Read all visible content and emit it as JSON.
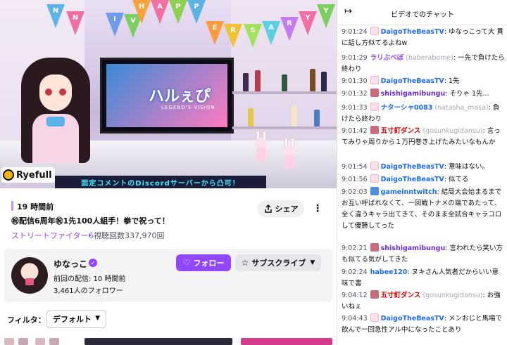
{
  "video": {
    "banner_letters": [
      "N",
      "N",
      "I",
      "V",
      "E",
      "R",
      "S",
      "A",
      "R",
      "Y",
      "H",
      "A",
      "P",
      "P",
      "Y"
    ],
    "tv_logo": "ハルぇぴ",
    "tv_sub": "LEGEND'S VISION",
    "marquee": "固定コメントのDiscordサーバーから凸可！",
    "sponsor": "Ryefull"
  },
  "info": {
    "time_ago": "19 時間前",
    "title": "㊗配信6周年㊗1先100人組手！拳で祝って！",
    "game": "ストリートファイター6",
    "views": "・視聴回数337,970回",
    "share_label": "シェア",
    "more_label": "⋮"
  },
  "channel": {
    "name": "ゆなっこ",
    "last_stream": "前回の配信: 10 時間前",
    "followers": "3,461人のフォロワー",
    "follow_label": "フォロー",
    "subscribe_label": "サブスクライブ"
  },
  "filter": {
    "label": "フィルタ：",
    "value": "デフォルト"
  },
  "chat": {
    "title": "ビデオでのチャット",
    "messages": [
      {
        "ts": "9:01:24",
        "badge": "bunny",
        "user": "DaigoTheBeasTV",
        "color": "#1e69ff",
        "alias": "",
        "text": "ゆなっこって大 貫に話し方似てるよねw"
      },
      {
        "ts": "9:01:29",
        "badge": "",
        "user": "ラリぶべぼ",
        "color": "#9147ff",
        "alias": "(baberabome)",
        "text": "一先で負けたら終わり"
      },
      {
        "ts": "9:01:30",
        "badge": "bunny",
        "user": "DaigoTheBeasTV",
        "color": "#1e69ff",
        "alias": "",
        "text": "1先"
      },
      {
        "ts": "9:01:32",
        "badge": "sub",
        "user": "shishigamibungu",
        "color": "#6a2cd6",
        "alias": "",
        "text": "そりゃ 1先..."
      },
      {
        "ts": "9:01:33",
        "badge": "bunny",
        "user": "ナターシャ0083",
        "color": "#1e69ff",
        "alias": "(natasha_masa)",
        "text": "負けたら終わり"
      },
      {
        "ts": "9:01:42",
        "badge": "sub",
        "user": "五寸釘ダンス",
        "color": "#e00000",
        "alias": "(gosunkugidansu)",
        "text": "言ってみりゃ周りから１万円巻き上げたみたいなもんか"
      },
      {
        "ts": "9:01:54",
        "badge": "bunny",
        "user": "DaigoTheBeasTV",
        "color": "#1e69ff",
        "alias": "",
        "text": "意味はない。"
      },
      {
        "ts": "9:01:56",
        "badge": "bunny",
        "user": "DaigoTheBeasTV",
        "color": "#1e69ff",
        "alias": "",
        "text": "似てる"
      },
      {
        "ts": "9:02:03",
        "badge": "prime",
        "user": "gameinntwitch",
        "color": "#1e69ff",
        "alias": "",
        "text": "結局大会始まるまでお互い呼ばれなくて、一回戦トナメの端であたって、全く違うキャラ出てきて、そのまま全試合キャラコロして優勝してった"
      },
      {
        "ts": "9:02:21",
        "badge": "sub",
        "user": "shishigamibungu",
        "color": "#6a2cd6",
        "alias": "",
        "text": "言われたら笑い方も似てる気がしてきた"
      },
      {
        "ts": "9:02:24",
        "badge": "",
        "user": "habee120",
        "color": "#1e69ff",
        "alias": "",
        "text": "ヌキさん人気者だからいい意味で書"
      },
      {
        "ts": "9:04:12",
        "badge": "sub",
        "user": "五寸釘ダンス",
        "color": "#e00000",
        "alias": "(gosunkugidansu)",
        "text": "お強いねぇ"
      },
      {
        "ts": "9:04:43",
        "badge": "bunny",
        "user": "DaigoTheBeasTV",
        "color": "#1e69ff",
        "alias": "",
        "text": "メンおじと馬場で飲んで一回急性アル中になったことあり"
      }
    ]
  }
}
